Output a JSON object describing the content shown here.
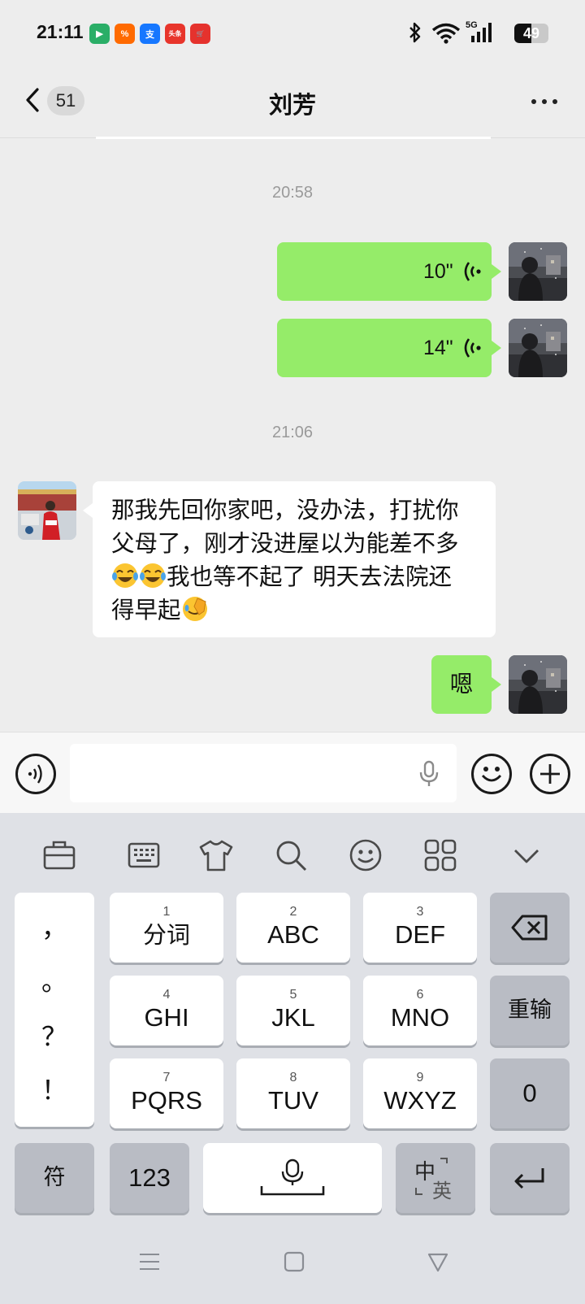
{
  "status_bar": {
    "time": "21:11",
    "app_icons": [
      {
        "name": "video-app-icon",
        "label": "▶",
        "color": "#2aae67"
      },
      {
        "name": "coupon-app-icon",
        "label": "%",
        "color": "#ff6a00"
      },
      {
        "name": "alipay-icon",
        "label": "支",
        "color": "#1677ff"
      },
      {
        "name": "toutiao-icon",
        "label": "头条",
        "color": "#e8352b"
      },
      {
        "name": "shopping-cart-app-icon",
        "label": "🛒",
        "color": "#e5322d"
      }
    ],
    "network": "5G",
    "battery": "49"
  },
  "header": {
    "unread_count": "51",
    "contact_name": "刘芳"
  },
  "messages": [
    {
      "type": "timestamp",
      "text": "20:58"
    },
    {
      "type": "voice",
      "side": "me",
      "duration": "10\""
    },
    {
      "type": "voice",
      "side": "me",
      "duration": "14\""
    },
    {
      "type": "timestamp",
      "text": "21:06"
    },
    {
      "type": "text",
      "side": "them",
      "lines": [
        "那我先回你家吧，没办法，打扰你",
        "父母了，刚才没进屋以为能差不多",
        "我也等不起了 明天去法院还",
        "得早起"
      ]
    },
    {
      "type": "text",
      "side": "me",
      "text": "嗯"
    }
  ],
  "keyboard": {
    "toolbar": [
      "toolbox-icon",
      "keyboard-icon",
      "skin-icon",
      "search-icon",
      "emoji-icon",
      "apps-icon",
      "collapse-icon"
    ],
    "punctuation": [
      "，",
      "。",
      "？",
      "！"
    ],
    "keys": [
      {
        "num": "1",
        "label": "分词"
      },
      {
        "num": "2",
        "label": "ABC"
      },
      {
        "num": "3",
        "label": "DEF"
      },
      {
        "num": "4",
        "label": "GHI"
      },
      {
        "num": "5",
        "label": "JKL"
      },
      {
        "num": "6",
        "label": "MNO"
      },
      {
        "num": "7",
        "label": "PQRS"
      },
      {
        "num": "8",
        "label": "TUV"
      },
      {
        "num": "9",
        "label": "WXYZ"
      }
    ],
    "reinput": "重输",
    "zero": "0",
    "symbols": "符",
    "numbers": "123",
    "lang_zh": "中",
    "lang_en": "英"
  },
  "colors": {
    "my_bubble": "#95ec69",
    "their_bubble": "#ffffff",
    "chat_bg": "#ededed"
  }
}
